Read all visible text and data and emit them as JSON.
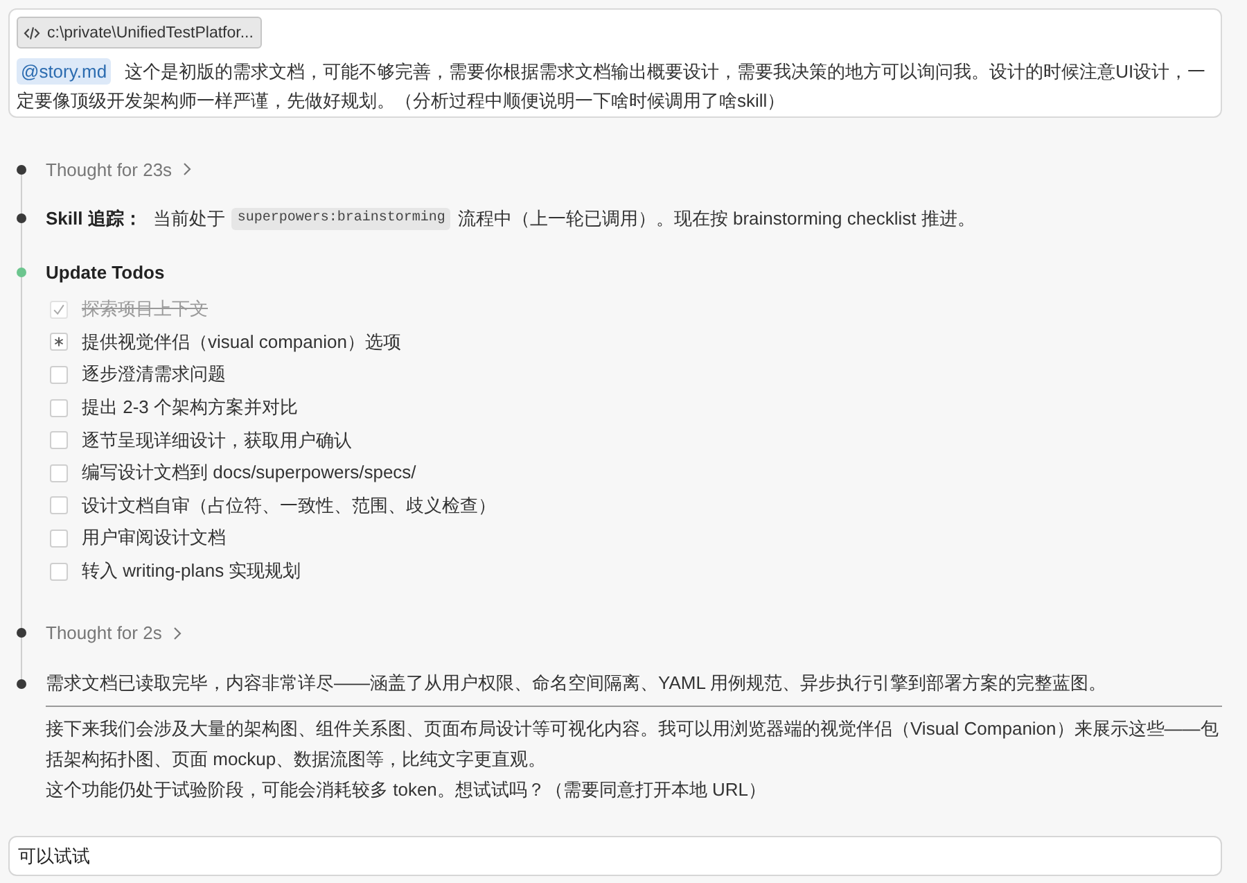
{
  "user_message": {
    "attachment": {
      "label": "c:\\private\\UnifiedTestPlatfor..."
    },
    "mention": "@story.md",
    "text": "这个是初版的需求文档，可能不够完善，需要你根据需求文档输出概要设计，需要我决策的地方可以询问我。设计的时候注意UI设计，一定要像顶级开发架构师一样严谨，先做好规划。（分析过程中顺便说明一下啥时候调用了啥skill）"
  },
  "timeline": [
    {
      "kind": "thought",
      "color": "#3a3a3a",
      "label": "Thought for 23s"
    },
    {
      "kind": "skill",
      "color": "#3a3a3a",
      "label": "Skill 追踪：",
      "text_before": "当前处于",
      "code": "superpowers:brainstorming",
      "text_after": "流程中（上一轮已调用）。现在按 brainstorming checklist 推进。"
    },
    {
      "kind": "todos",
      "color": "#6cc58e",
      "title": "Update Todos",
      "todos": [
        {
          "kind": "done",
          "text": "探索项目上下文"
        },
        {
          "kind": "active",
          "text": "提供视觉伴侣（visual companion）选项"
        },
        {
          "kind": "pending",
          "text": "逐步澄清需求问题"
        },
        {
          "kind": "pending",
          "text": "提出 2-3 个架构方案并对比"
        },
        {
          "kind": "pending",
          "text": "逐节呈现详细设计，获取用户确认"
        },
        {
          "kind": "pending",
          "text": "编写设计文档到 docs/superpowers/specs/"
        },
        {
          "kind": "pending",
          "text": "设计文档自审（占位符、一致性、范围、歧义检查）"
        },
        {
          "kind": "pending",
          "text": "用户审阅设计文档"
        },
        {
          "kind": "pending",
          "text": "转入 writing-plans 实现规划"
        }
      ]
    },
    {
      "kind": "thought",
      "color": "#3a3a3a",
      "label": "Thought for 2s"
    },
    {
      "kind": "message",
      "color": "#3a3a3a",
      "lead": "需求文档已读取完毕，内容非常详尽——涵盖了从用户权限、命名空间隔离、YAML 用例规范、异步执行引擎到部署方案的完整蓝图。",
      "paragraphs": [
        "接下来我们会涉及大量的架构图、组件关系图、页面布局设计等可视化内容。我可以用浏览器端的视觉伴侣（Visual Companion）来展示这些——包括架构拓扑图、页面 mockup、数据流图等，比纯文字更直观。",
        "这个功能仍处于试验阶段，可能会消耗较多 token。想试试吗？（需要同意打开本地 URL）"
      ]
    }
  ],
  "composer": {
    "value": "可以试试"
  }
}
